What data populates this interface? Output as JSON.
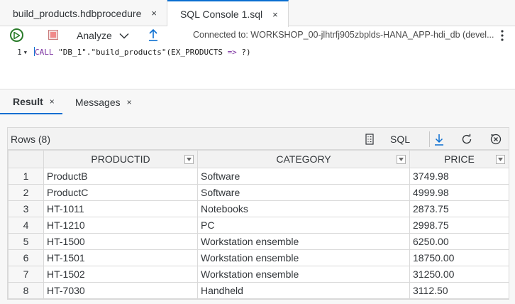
{
  "editor_tabs": [
    {
      "label": "build_products.hdbprocedure",
      "close": "×"
    },
    {
      "label": "SQL Console 1.sql",
      "close": "×"
    }
  ],
  "toolbar": {
    "analyze_label": "Analyze",
    "connection": "Connected to: WORKSHOP_00-jlhtrfj905zbplds-HANA_APP-hdi_db (devel..."
  },
  "editor": {
    "line_number": "1",
    "tokens": [
      "CALL",
      " ",
      "\"DB_1\"",
      ".",
      "\"build_products\"",
      "(EX_PRODUCTS ",
      "=>",
      " ?)"
    ]
  },
  "result_tabs": [
    {
      "label": "Result",
      "close": "×"
    },
    {
      "label": "Messages",
      "close": "×"
    }
  ],
  "grid": {
    "rows_label": "Rows (8)",
    "sql_label": "SQL",
    "columns": [
      "PRODUCTID",
      "CATEGORY",
      "PRICE"
    ],
    "rows": [
      [
        "1",
        "ProductB",
        "Software",
        "3749.98"
      ],
      [
        "2",
        "ProductC",
        "Software",
        "4999.98"
      ],
      [
        "3",
        "HT-1011",
        "Notebooks",
        "2873.75"
      ],
      [
        "4",
        "HT-1210",
        "PC",
        "2998.75"
      ],
      [
        "5",
        "HT-1500",
        "Workstation ensemble",
        "6250.00"
      ],
      [
        "6",
        "HT-1501",
        "Workstation ensemble",
        "18750.00"
      ],
      [
        "7",
        "HT-1502",
        "Workstation ensemble",
        "31250.00"
      ],
      [
        "8",
        "HT-7030",
        "Handheld",
        "3112.50"
      ]
    ]
  },
  "colors": {
    "accent": "#0a6ed1",
    "run_green": "#2b7c2b",
    "keyword_purple": "#7b30a0"
  },
  "icons": [
    "run-icon",
    "stop-icon",
    "chevron-down-icon",
    "export-icon",
    "more-icon",
    "columns-icon",
    "download-icon",
    "refresh-icon",
    "clear-filter-icon",
    "filter-icon"
  ]
}
